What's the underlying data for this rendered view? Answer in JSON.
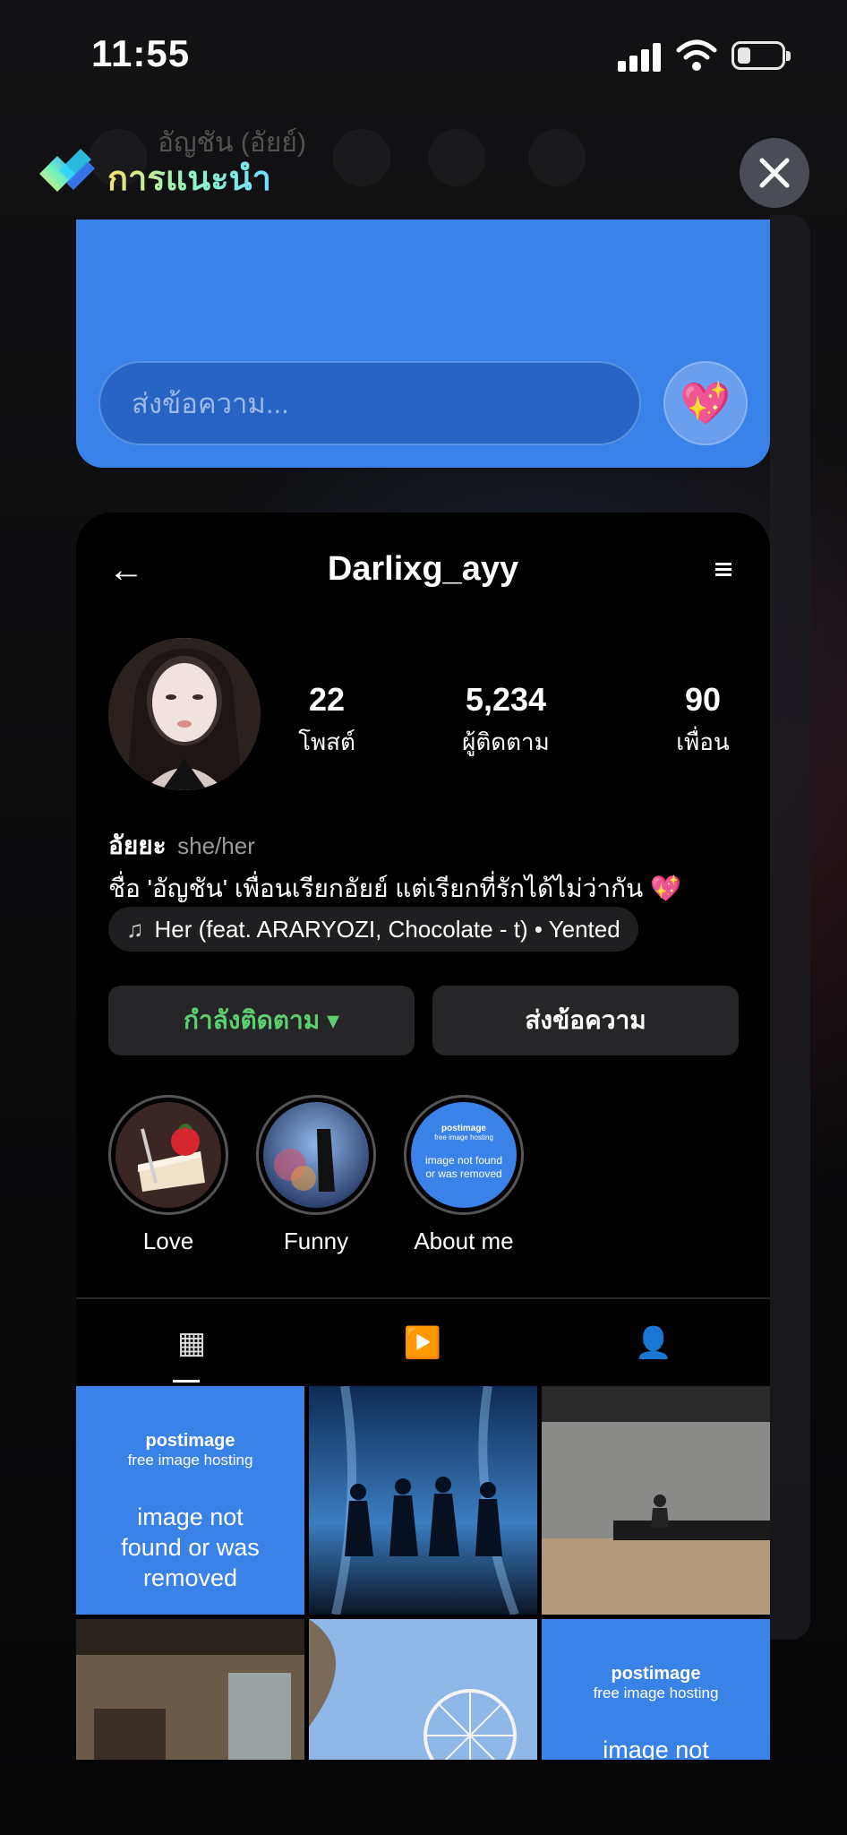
{
  "status_bar": {
    "time": "11:55"
  },
  "background_header": {
    "name": "อัญชัน (อัยย์)"
  },
  "recommendation": {
    "title": "การแนะนำ"
  },
  "message_card": {
    "input_placeholder": "ส่งข้อความ...",
    "heart_emoji": "💖"
  },
  "profile": {
    "back_symbol": "←",
    "username": "Darlixg_ayy",
    "stats": [
      {
        "value": "22",
        "label": "โพสต์"
      },
      {
        "value": "5,234",
        "label": "ผู้ติดตาม"
      },
      {
        "value": "90",
        "label": "เพื่อน"
      }
    ],
    "display_name": "อัยยะ",
    "pronouns": "she/her",
    "bio": "ชื่อ 'อัญชัน' เพื่อนเรียกอัยย์ แต่เรียกที่รักได้ไม่ว่ากัน 💖",
    "music": "Her (feat. ARARYOZI, Chocolate - t) • Yented",
    "follow_button": "กำลังติดตาม ▾",
    "message_button": "ส่งข้อความ",
    "highlights": [
      {
        "label": "Love"
      },
      {
        "label": "Funny"
      },
      {
        "label": "About me"
      }
    ],
    "tabs": [
      {
        "icon": "grid-icon",
        "glyph": "▦"
      },
      {
        "icon": "reels-icon",
        "glyph": "▶️"
      },
      {
        "icon": "tagged-icon",
        "glyph": "👤"
      }
    ]
  },
  "placeholder_image": {
    "brand": "postimage",
    "tagline": "free image hosting",
    "message": "image not found or was removed"
  },
  "colors": {
    "accent_blue": "#3b82e8",
    "follow_green": "#5ccf6e"
  }
}
